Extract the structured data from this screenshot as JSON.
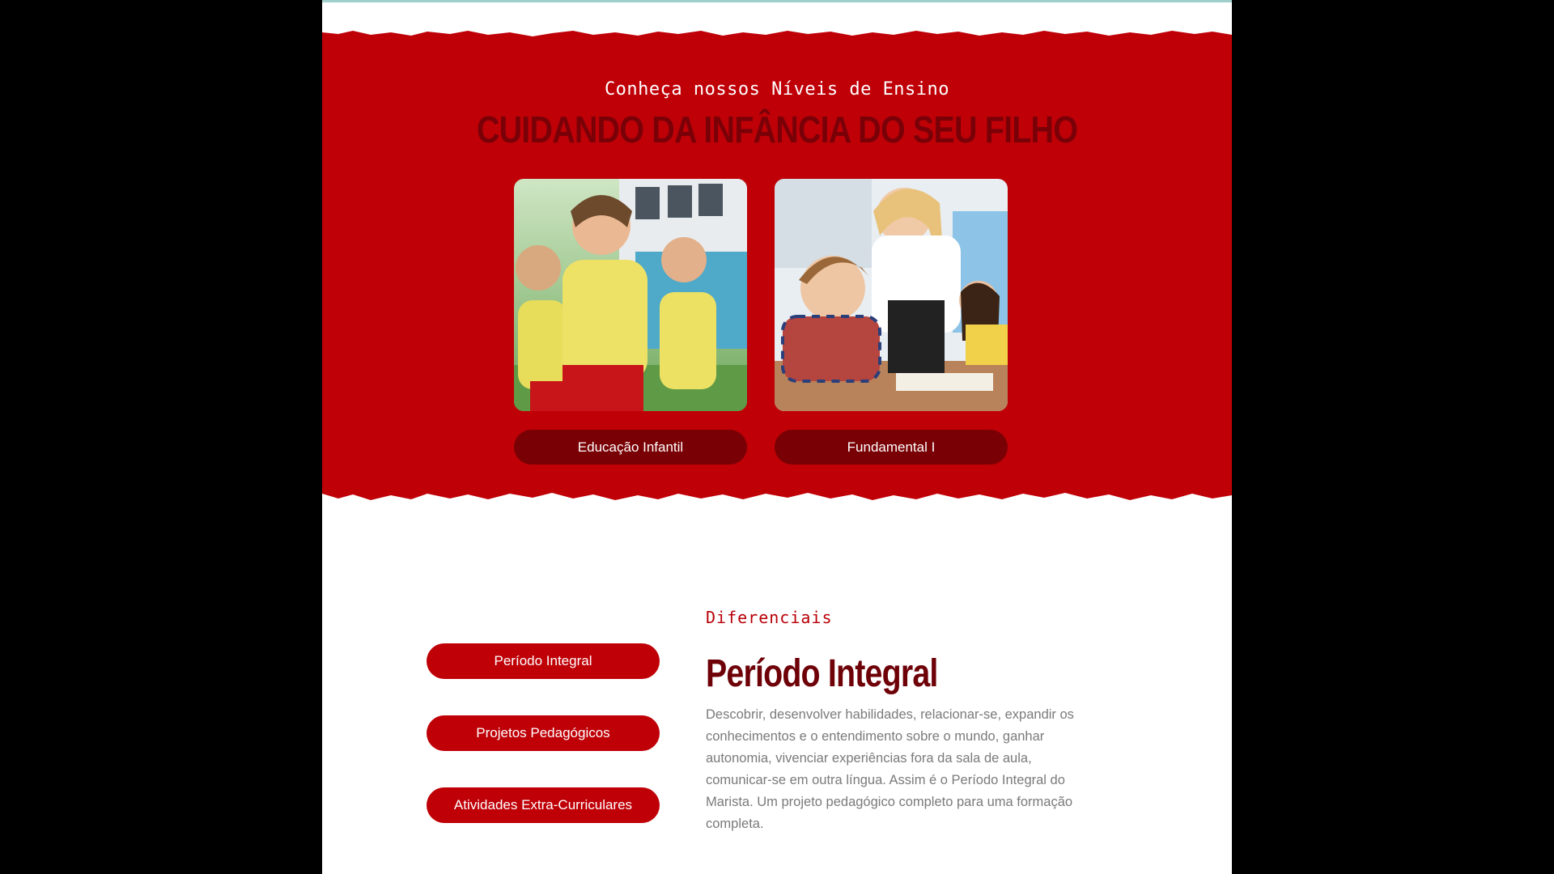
{
  "colors": {
    "brand_red": "#bf0007",
    "dark_red": "#790004",
    "title_red": "#7a0008",
    "body_text": "#7a7a7a",
    "accent_strip": "#9fcfcb"
  },
  "hero": {
    "eyebrow": "Conheça nossos Níveis de Ensino",
    "title": "CUIDANDO DA INFÂNCIA DO SEU FILHO",
    "cards": [
      {
        "image": "children-running-photo",
        "label": "Educação Infantil"
      },
      {
        "image": "teacher-helping-student-photo",
        "label": "Fundamental I"
      }
    ]
  },
  "diferenciais": {
    "eyebrow": "Diferenciais",
    "tabs": [
      {
        "label": "Período Integral"
      },
      {
        "label": "Projetos Pedagógicos"
      },
      {
        "label": "Atividades Extra-Curriculares"
      }
    ],
    "active": {
      "heading": "Período Integral",
      "body": "Descobrir, desenvolver habilidades, relacionar-se, expandir os conhecimentos e o entendimento sobre o mundo, ganhar autonomia, vivenciar experiências fora da sala de aula, comunicar-se em outra língua. Assim é o Período Integral do Marista. Um projeto pedagógico completo para uma formação completa."
    }
  }
}
